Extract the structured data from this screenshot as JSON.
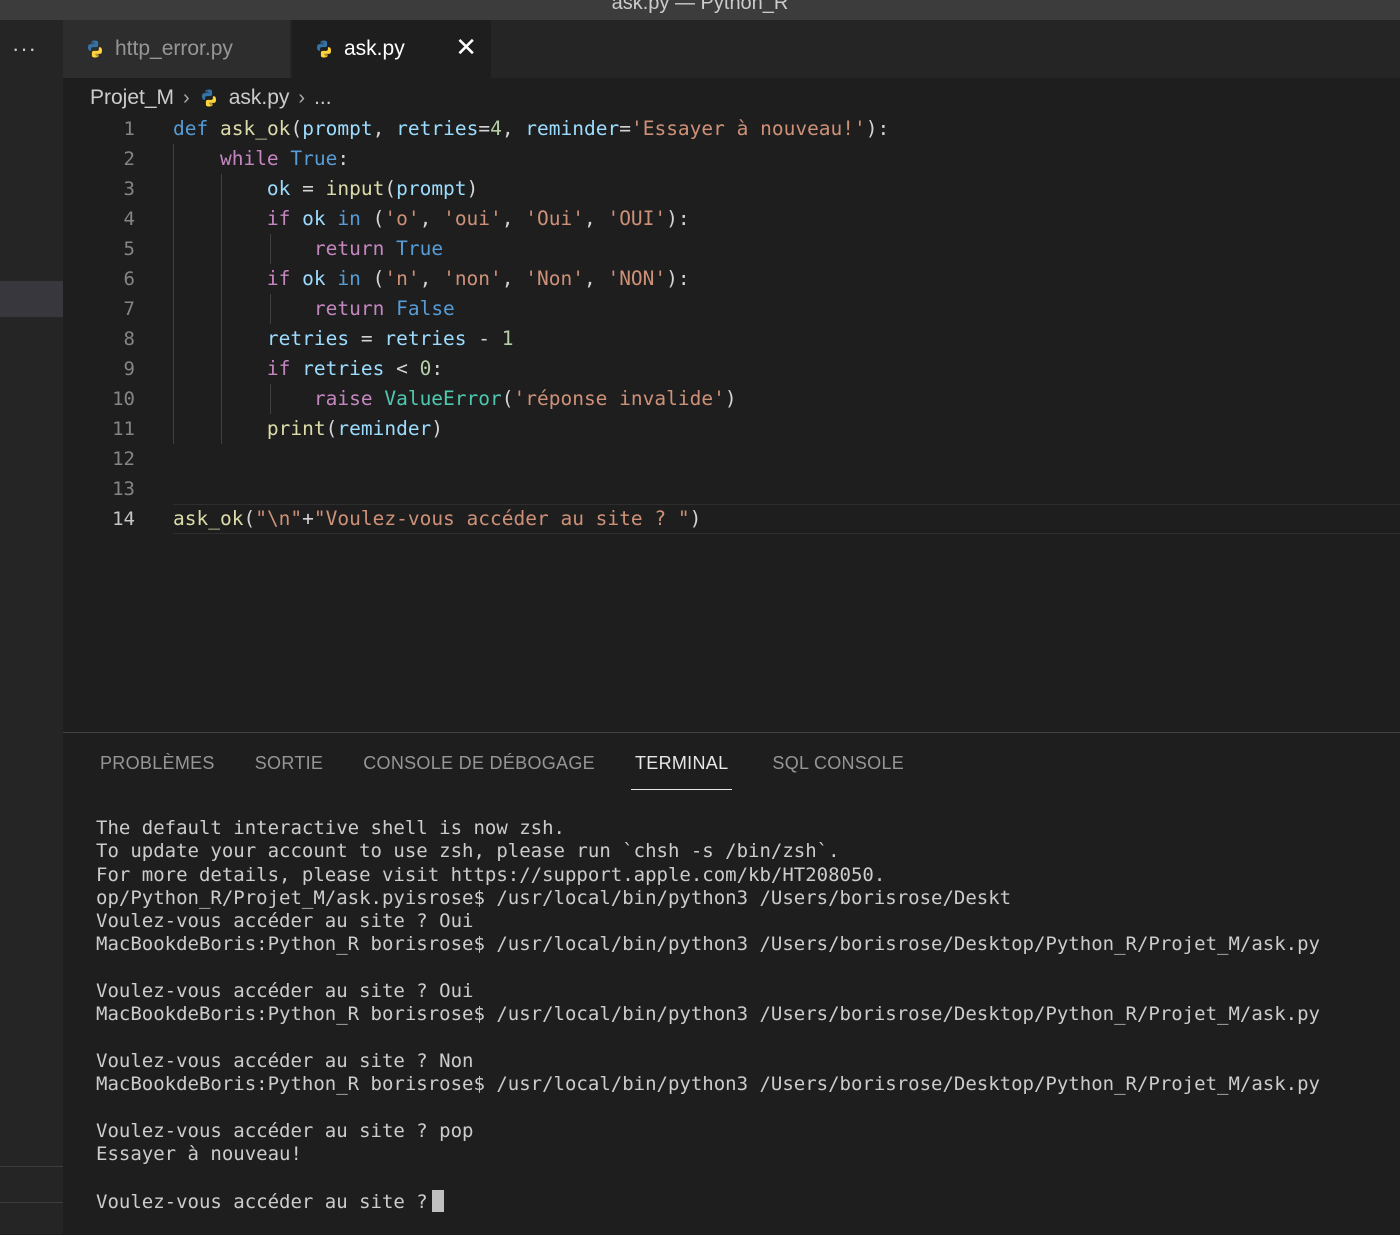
{
  "window": {
    "title": "ask.py — Python_R"
  },
  "sidebar": {
    "more_label": "···"
  },
  "tabs": [
    {
      "label": "http_error.py",
      "icon": "python-icon",
      "active": false
    },
    {
      "label": "ask.py",
      "icon": "python-icon",
      "active": true,
      "close": "✕"
    }
  ],
  "breadcrumb": {
    "folder": "Projet_M",
    "file": "ask.py",
    "more": "..."
  },
  "editor": {
    "line_numbers": [
      "1",
      "2",
      "3",
      "4",
      "5",
      "6",
      "7",
      "8",
      "9",
      "10",
      "11",
      "12",
      "13",
      "14"
    ],
    "current_line": "14",
    "lines": [
      [
        [
          "kw",
          "def"
        ],
        [
          "punc",
          " "
        ],
        [
          "fn",
          "ask_ok"
        ],
        [
          "punc",
          "("
        ],
        [
          "var",
          "prompt"
        ],
        [
          "punc",
          ", "
        ],
        [
          "var",
          "retries"
        ],
        [
          "punc",
          "="
        ],
        [
          "num",
          "4"
        ],
        [
          "punc",
          ", "
        ],
        [
          "var",
          "reminder"
        ],
        [
          "punc",
          "="
        ],
        [
          "str",
          "'Essayer à nouveau!'"
        ],
        [
          "punc",
          "):"
        ]
      ],
      [
        [
          "punc",
          "    "
        ],
        [
          "ctl",
          "while"
        ],
        [
          "punc",
          " "
        ],
        [
          "kw",
          "True"
        ],
        [
          "punc",
          ":"
        ]
      ],
      [
        [
          "punc",
          "        "
        ],
        [
          "var",
          "ok"
        ],
        [
          "punc",
          " = "
        ],
        [
          "fn",
          "input"
        ],
        [
          "punc",
          "("
        ],
        [
          "var",
          "prompt"
        ],
        [
          "punc",
          ")"
        ]
      ],
      [
        [
          "punc",
          "        "
        ],
        [
          "ctl",
          "if"
        ],
        [
          "punc",
          " "
        ],
        [
          "var",
          "ok"
        ],
        [
          "punc",
          " "
        ],
        [
          "kw",
          "in"
        ],
        [
          "punc",
          " ("
        ],
        [
          "str",
          "'o'"
        ],
        [
          "punc",
          ", "
        ],
        [
          "str",
          "'oui'"
        ],
        [
          "punc",
          ", "
        ],
        [
          "str",
          "'Oui'"
        ],
        [
          "punc",
          ", "
        ],
        [
          "str",
          "'OUI'"
        ],
        [
          "punc",
          "):"
        ]
      ],
      [
        [
          "punc",
          "            "
        ],
        [
          "ctl",
          "return"
        ],
        [
          "punc",
          " "
        ],
        [
          "kw",
          "True"
        ]
      ],
      [
        [
          "punc",
          "        "
        ],
        [
          "ctl",
          "if"
        ],
        [
          "punc",
          " "
        ],
        [
          "var",
          "ok"
        ],
        [
          "punc",
          " "
        ],
        [
          "kw",
          "in"
        ],
        [
          "punc",
          " ("
        ],
        [
          "str",
          "'n'"
        ],
        [
          "punc",
          ", "
        ],
        [
          "str",
          "'non'"
        ],
        [
          "punc",
          ", "
        ],
        [
          "str",
          "'Non'"
        ],
        [
          "punc",
          ", "
        ],
        [
          "str",
          "'NON'"
        ],
        [
          "punc",
          "):"
        ]
      ],
      [
        [
          "punc",
          "            "
        ],
        [
          "ctl",
          "return"
        ],
        [
          "punc",
          " "
        ],
        [
          "kw",
          "False"
        ]
      ],
      [
        [
          "punc",
          "        "
        ],
        [
          "var",
          "retries"
        ],
        [
          "punc",
          " = "
        ],
        [
          "var",
          "retries"
        ],
        [
          "punc",
          " - "
        ],
        [
          "num",
          "1"
        ]
      ],
      [
        [
          "punc",
          "        "
        ],
        [
          "ctl",
          "if"
        ],
        [
          "punc",
          " "
        ],
        [
          "var",
          "retries"
        ],
        [
          "punc",
          " < "
        ],
        [
          "num",
          "0"
        ],
        [
          "punc",
          ":"
        ]
      ],
      [
        [
          "punc",
          "            "
        ],
        [
          "ctl",
          "raise"
        ],
        [
          "punc",
          " "
        ],
        [
          "cls",
          "ValueError"
        ],
        [
          "punc",
          "("
        ],
        [
          "str",
          "'réponse invalide'"
        ],
        [
          "punc",
          ")"
        ]
      ],
      [
        [
          "punc",
          "        "
        ],
        [
          "fn",
          "print"
        ],
        [
          "punc",
          "("
        ],
        [
          "var",
          "reminder"
        ],
        [
          "punc",
          ")"
        ]
      ],
      [],
      [],
      [
        [
          "fn",
          "ask_ok"
        ],
        [
          "punc",
          "("
        ],
        [
          "str",
          "\"\\n\""
        ],
        [
          "punc",
          "+"
        ],
        [
          "str",
          "\"Voulez-vous accéder au site ? \""
        ],
        [
          "punc",
          ")"
        ]
      ]
    ]
  },
  "panel": {
    "tabs": [
      "PROBLÈMES",
      "SORTIE",
      "CONSOLE DE DÉBOGAGE",
      "TERMINAL",
      "SQL CONSOLE"
    ],
    "active_tab": "TERMINAL",
    "terminal_lines": [
      "The default interactive shell is now zsh.",
      "To update your account to use zsh, please run `chsh -s /bin/zsh`.",
      "For more details, please visit https://support.apple.com/kb/HT208050.",
      "op/Python_R/Projet_M/ask.pyisrose$ /usr/local/bin/python3 /Users/borisrose/Deskt",
      "Voulez-vous accéder au site ? Oui",
      "MacBookdeBoris:Python_R borisrose$ /usr/local/bin/python3 /Users/borisrose/Desktop/Python_R/Projet_M/ask.py",
      "",
      "Voulez-vous accéder au site ? Oui",
      "MacBookdeBoris:Python_R borisrose$ /usr/local/bin/python3 /Users/borisrose/Desktop/Python_R/Projet_M/ask.py",
      "",
      "Voulez-vous accéder au site ? Non",
      "MacBookdeBoris:Python_R borisrose$ /usr/local/bin/python3 /Users/borisrose/Desktop/Python_R/Projet_M/ask.py",
      "",
      "Voulez-vous accéder au site ? pop",
      "Essayer à nouveau!",
      ""
    ],
    "prompt_line": "Voulez-vous accéder au site ?"
  },
  "colors": {
    "keyword": "#569cd6",
    "control": "#c586c0",
    "function": "#dcdcaa",
    "variable": "#9cdcfe",
    "string": "#ce9178",
    "number": "#b5cea8",
    "class": "#4ec9b0",
    "python_blue": "#3572a5",
    "python_yellow": "#ffd43b"
  }
}
